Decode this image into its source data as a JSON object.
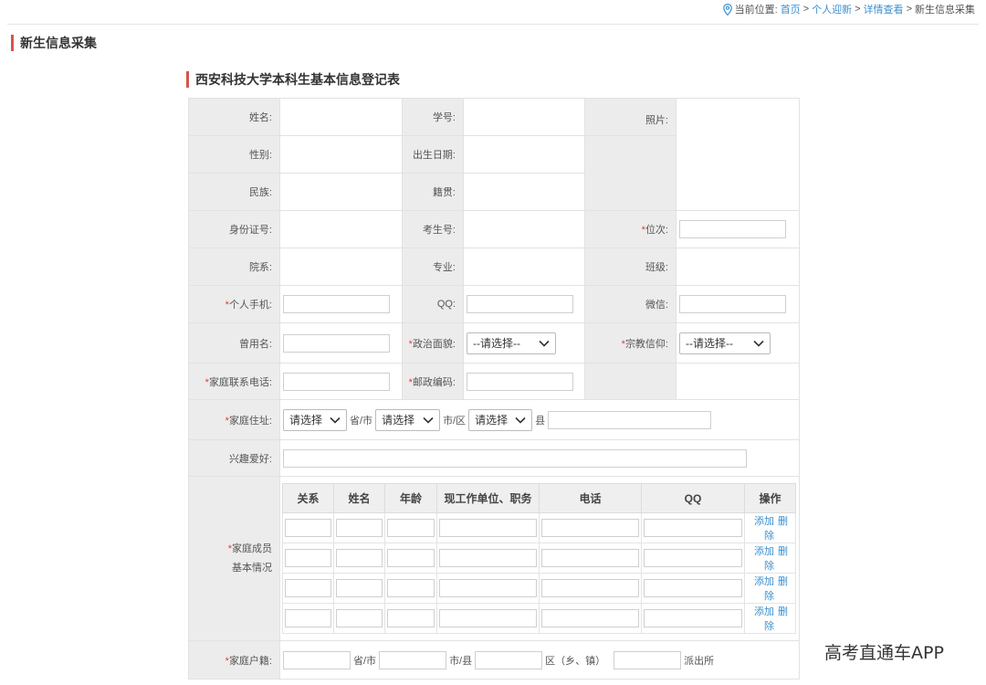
{
  "breadcrumb": {
    "prefix": "当前位置:",
    "items": [
      "首页",
      "个人迎新",
      "详情查看"
    ],
    "sep": ">",
    "current": "新生信息采集"
  },
  "page_title": "新生信息采集",
  "form_title": "西安科技大学本科生基本信息登记表",
  "fields": {
    "name": "姓名:",
    "student_id": "学号:",
    "photo": "照片:",
    "gender": "性别:",
    "birth_date": "出生日期:",
    "ethnicity": "民族:",
    "native_place": "籍贯:",
    "id_number": "身份证号:",
    "exam_number": "考生号:",
    "rank": "位次:",
    "department": "院系:",
    "major": "专业:",
    "class": "班级:",
    "mobile": "个人手机:",
    "qq": "QQ:",
    "wechat": "微信:",
    "former_name": "曾用名:",
    "political_status": "政治面貌:",
    "religion": "宗教信仰:",
    "home_phone": "家庭联系电话:",
    "postal_code": "邮政编码:",
    "home_address": "家庭住址:",
    "hobbies": "兴趣爱好:",
    "family_members_1": "家庭成员",
    "family_members_2": "基本情况",
    "household": "家庭户籍:"
  },
  "required_mark": "*",
  "selects": {
    "political_status": "--请选择--",
    "religion": "--请选择--",
    "province": "请选择",
    "city": "请选择",
    "county": "请选择"
  },
  "units": {
    "province": "省/市",
    "city": "市/区",
    "county": "县",
    "hh_province": "省/市",
    "hh_city": "市/县",
    "hh_district": "区（乡、镇）",
    "hh_police": "派出所"
  },
  "family_table": {
    "headers": [
      "关系",
      "姓名",
      "年龄",
      "现工作单位、职务",
      "电话",
      "QQ",
      "操作"
    ],
    "rows": [
      {
        "add": "添加",
        "delete": "删除"
      },
      {
        "add": "添加",
        "delete": "删除"
      },
      {
        "add": "添加",
        "delete": "删除"
      },
      {
        "add": "添加",
        "delete": "删除"
      }
    ]
  },
  "watermark": "高考直通车APP",
  "colors": {
    "accent": "#d9534f",
    "link": "#3a8fd0",
    "required": "#e4393c",
    "label_bg": "#ececec"
  }
}
